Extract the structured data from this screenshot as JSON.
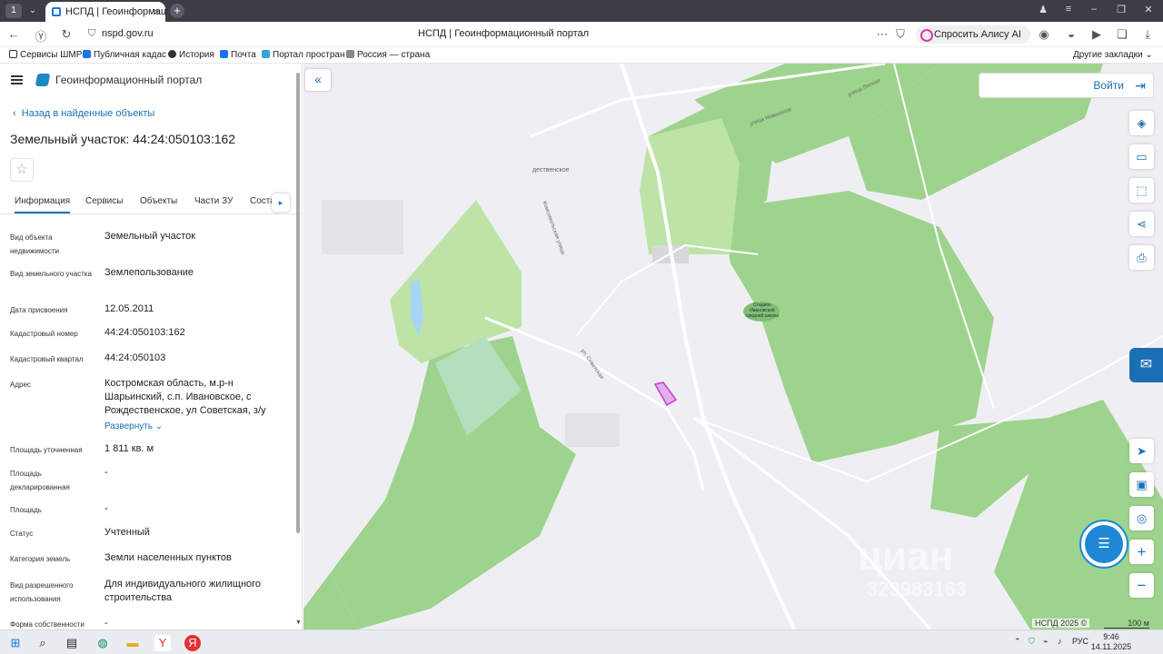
{
  "browser": {
    "tab_count": "1",
    "tab_title": "НСПД | Геоинформационн",
    "url": "nspd.gov.ru",
    "page_title": "НСПД | Геоинформационный портал",
    "alice_label": "Спросить Алису AI"
  },
  "bookmarks": {
    "items": [
      "Сервисы ШМР",
      "Публичная кадас",
      "История",
      "Почта",
      "Портал простран",
      "Россия — страна"
    ],
    "other": "Другие закладки"
  },
  "panel": {
    "portal_name": "Геоинформационный портал",
    "back_label": "Назад в найденные объекты",
    "title": "Земельный участок: 44:24:050103:162",
    "tabs": [
      "Информация",
      "Сервисы",
      "Объекты",
      "Части ЗУ",
      "Соста"
    ],
    "fields": [
      {
        "label": "Вид объекта недвижимости",
        "value": "Земельный участок"
      },
      {
        "label": "Вид земельного участка",
        "value": "Землепользование"
      },
      {
        "label": "Дата присвоения",
        "value": "12.05.2011"
      },
      {
        "label": "Кадастровый номер",
        "value": "44:24:050103:162"
      },
      {
        "label": "Кадастровый квартал",
        "value": "44:24:050103"
      },
      {
        "label": "Адрес",
        "value": "Костромская область, м.р-н Шарьинский, с.п. Ивановское, с Рождественское, ул Советская, з/у"
      },
      {
        "label": "Площадь уточненная",
        "value": "1 811 кв. м"
      },
      {
        "label": "Площадь декларированная",
        "value": "-"
      },
      {
        "label": "Площадь",
        "value": "-"
      },
      {
        "label": "Статус",
        "value": "Учтенный"
      },
      {
        "label": "Категория земель",
        "value": "Земли населенных пунктов"
      },
      {
        "label": "Вид разрешенного использования",
        "value": "Для индивидуального жилищного строительства"
      },
      {
        "label": "Форма собственности",
        "value": "-"
      }
    ],
    "expand_label": "Развернуть"
  },
  "map": {
    "login_label": "Войти",
    "copyright": "НСПД 2025 ©",
    "scale": "100 м",
    "labels": {
      "village": "дествен­ское",
      "street1": "ул. Советская",
      "street2": "Комсомольская улица",
      "street3": "улица Новоселов",
      "street4": "улица Лесная",
      "school": "Стадион Ивановской средней школы"
    },
    "watermark": "циан",
    "watermark_phone": "323983163",
    "colors": {
      "forest": "#9ed38e",
      "meadow": "#bde3a6",
      "background": "#efeff3",
      "parcel": "#c93bd6"
    }
  },
  "taskbar": {
    "lang": "РУС",
    "time": "9:46",
    "date": "14.11.2025"
  }
}
